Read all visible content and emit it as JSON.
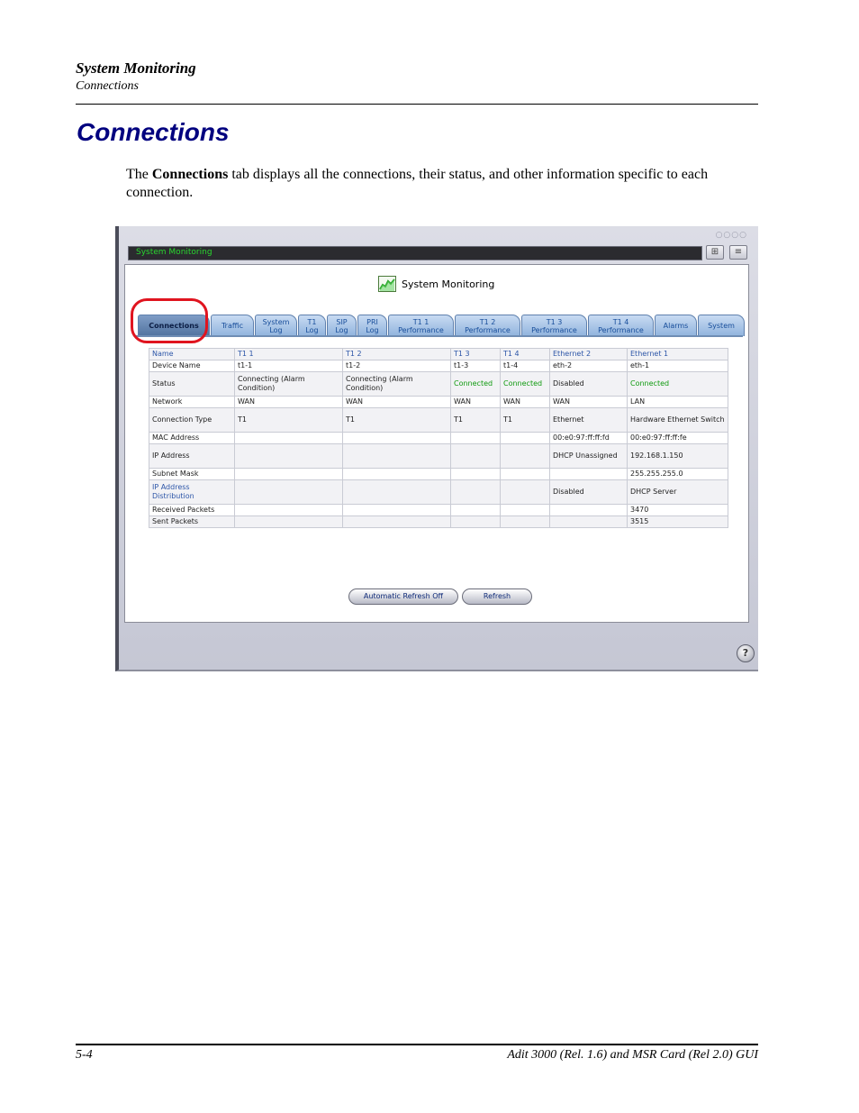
{
  "header": {
    "title": "System Monitoring",
    "subtitle": "Connections"
  },
  "section": {
    "title": "Connections"
  },
  "intro": {
    "pre": "The ",
    "bold": "Connections",
    "post": " tab displays all the connections, their status, and other information specific to each connection."
  },
  "app": {
    "titlebar": "System Monitoring",
    "logo_text": "System Monitoring",
    "tabs": [
      {
        "label": "Connections"
      },
      {
        "label": "Traffic"
      },
      {
        "label": "System Log"
      },
      {
        "label": "T1 Log"
      },
      {
        "label": "SIP Log"
      },
      {
        "label": "PRI Log"
      },
      {
        "label": "T1 1 Performance"
      },
      {
        "label": "T1 2 Performance"
      },
      {
        "label": "T1 3 Performance"
      },
      {
        "label": "T1 4 Performance"
      },
      {
        "label": "Alarms"
      },
      {
        "label": "System"
      }
    ],
    "table": {
      "header": [
        "Name",
        "T1 1",
        "T1 2",
        "T1 3",
        "T1 4",
        "Ethernet 2",
        "Ethernet 1"
      ],
      "rows": [
        [
          "Device Name",
          "t1-1",
          "t1-2",
          "t1-3",
          "t1-4",
          "eth-2",
          "eth-1"
        ],
        [
          "Status",
          "Connecting (Alarm Condition)",
          "Connecting (Alarm Condition)",
          "Connected",
          "Connected",
          "Disabled",
          "Connected"
        ],
        [
          "Network",
          "WAN",
          "WAN",
          "WAN",
          "WAN",
          "WAN",
          "LAN"
        ],
        [
          "Connection Type",
          "T1",
          "T1",
          "T1",
          "T1",
          "Ethernet",
          "Hardware Ethernet Switch"
        ],
        [
          "MAC Address",
          "",
          "",
          "",
          "",
          "00:e0:97:ff:ff:fd",
          "00:e0:97:ff:ff:fe"
        ],
        [
          "IP Address",
          "",
          "",
          "",
          "",
          "DHCP Unassigned",
          "192.168.1.150"
        ],
        [
          "Subnet Mask",
          "",
          "",
          "",
          "",
          "",
          "255.255.255.0"
        ],
        [
          "IP Address Distribution",
          "",
          "",
          "",
          "",
          "Disabled",
          "DHCP Server"
        ],
        [
          "Received Packets",
          "",
          "",
          "",
          "",
          "",
          "3470"
        ],
        [
          "Sent Packets",
          "",
          "",
          "",
          "",
          "",
          "3515"
        ]
      ]
    },
    "buttons": {
      "auto_refresh": "Automatic Refresh Off",
      "refresh": "Refresh"
    },
    "help": "?"
  },
  "footer": {
    "page": "5-4",
    "doc": "Adit 3000 (Rel. 1.6) and MSR Card (Rel 2.0) GUI"
  },
  "colors": {
    "heading": "#00007f",
    "connected": "#0f9a0f",
    "highlight": "#e0141f",
    "tab": "#90b3dd"
  }
}
